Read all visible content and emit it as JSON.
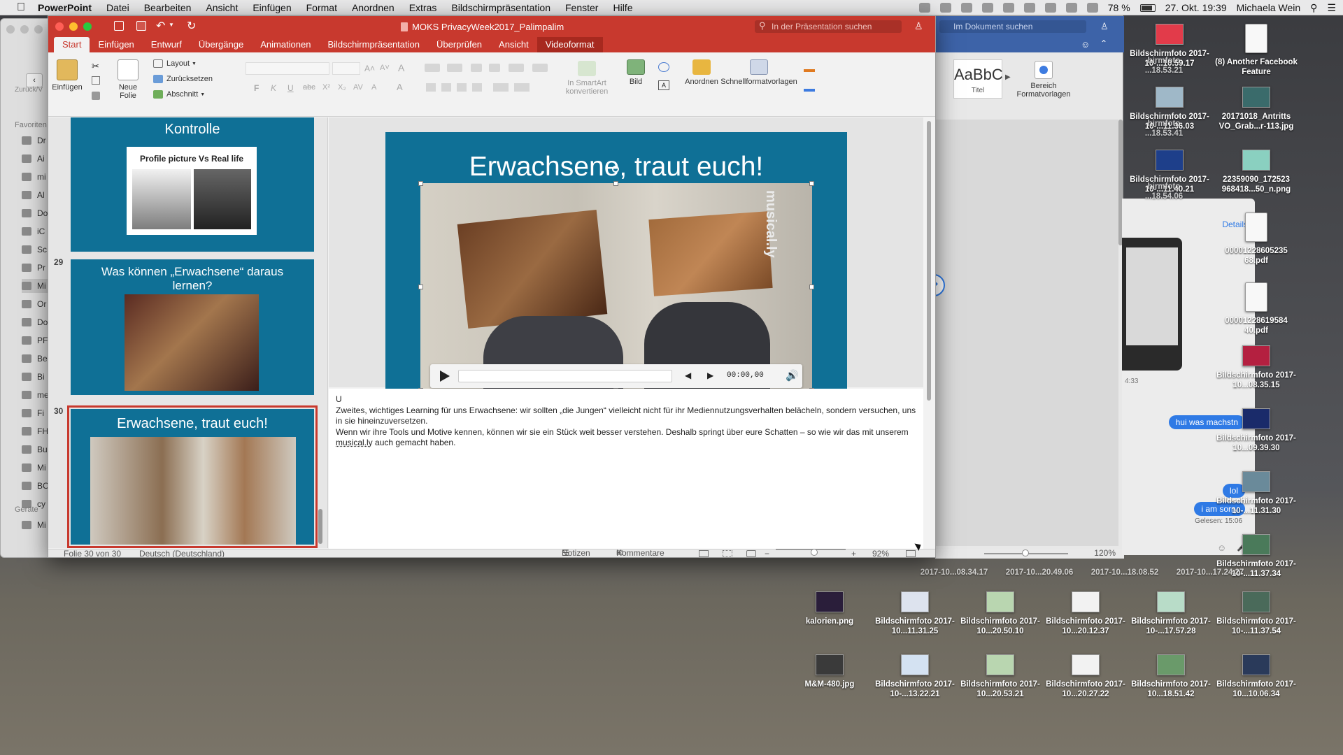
{
  "menubar": {
    "app": "PowerPoint",
    "items": [
      "Datei",
      "Bearbeiten",
      "Ansicht",
      "Einfügen",
      "Format",
      "Anordnen",
      "Extras",
      "Bildschirmpräsentation",
      "Fenster",
      "Hilfe"
    ],
    "battery": "78 %",
    "datetime": "27. Okt. 19:39",
    "user": "Michaela Wein"
  },
  "finder": {
    "back_label": "Zurück/V",
    "favorites_label": "Favoriten",
    "devices_label": "Geräte",
    "items": [
      "Dr",
      "Ai",
      "mi",
      "Al",
      "Do",
      "iC",
      "Sc",
      "Pr",
      "Mi",
      "Or",
      "Do",
      "PF",
      "Be",
      "Bi",
      "me",
      "Fi",
      "FH",
      "Bu",
      "Mi",
      "BC",
      "cy"
    ],
    "device_items": [
      "Mi"
    ]
  },
  "ppt": {
    "title": "MOKS PrivacyWeek2017_Palimpalim",
    "search_placeholder": "In der Präsentation suchen",
    "tabs": [
      "Start",
      "Einfügen",
      "Entwurf",
      "Übergänge",
      "Animationen",
      "Bildschirmpräsentation",
      "Überprüfen",
      "Ansicht",
      "Videoformat"
    ],
    "ribbon": {
      "paste": "Einfügen",
      "new_slide": "Neue Folie",
      "layout": "Layout",
      "reset": "Zurücksetzen",
      "section": "Abschnitt",
      "smartart": "In SmartArt konvertieren",
      "picture": "Bild",
      "arrange": "Anordnen",
      "quickstyles": "Schnellformatvorlagen"
    },
    "thumbnails": [
      {
        "number": "",
        "title": "Kontrolle",
        "caption": "Profile picture Vs Real life"
      },
      {
        "number": "29",
        "title": "Was können „Erwachsene“ daraus lernen?"
      },
      {
        "number": "30",
        "title": "Erwachsene, traut euch!"
      }
    ],
    "slide": {
      "title": "Erwachsene, traut euch!",
      "video_watermark": "musical.ly",
      "time": "00:00,00"
    },
    "notes": {
      "line0": "U",
      "p1": "Zweites, wichtiges Learning für uns Erwachsene: wir sollten „die Jungen“ vielleicht nicht für ihr Mediennutzungsverhalten belächeln, sondern versuchen, uns in sie hineinzuversetzen.",
      "p2a": "Wenn wir ihre Tools und Motive kennen, können wir sie ein Stück weit besser verstehen. Deshalb springt über eure Schatten – so wie wir das mit unserem ",
      "p2link": "musical.ly",
      "p2b": " auch gemacht haben."
    },
    "status": {
      "slide_of": "Folie 30 von 30",
      "language": "Deutsch (Deutschland)",
      "notes": "Notizen",
      "comments": "Kommentare",
      "zoom": "92%"
    }
  },
  "word": {
    "search_placeholder": "Im Dokument suchen",
    "style_sample": "AaBbC",
    "style_name": "Titel",
    "pane_label": "Bereich Formatvorlagen",
    "zoom": "120%"
  },
  "messages": {
    "details": "Details",
    "timestamp": "4:33",
    "bubbles": [
      "hui was machstn",
      "lol",
      "i am sorry"
    ],
    "read": "Gelesen: 15:06"
  },
  "desktop_icons": [
    {
      "label": "Bildschirmfoto 2017-10-...10.59.17"
    },
    {
      "label": "(8) Another Facebook Feature"
    },
    {
      "label": "Bildschirmfoto 2017-10-...11.36.03"
    },
    {
      "label": "20171018_Antritts VO_Grab...r-113.jpg"
    },
    {
      "label": "Bildschirmfoto 2017-10-...11.40.21"
    },
    {
      "label": "22359090_172523 968418...50_n.png"
    },
    {
      "label": "00001228605235 68.pdf"
    },
    {
      "label": "00001228619584 40.pdf"
    },
    {
      "label": "Bildschirmfoto 2017-10...08.35.15"
    },
    {
      "label": "Bildschirmfoto 2017-10...09.39.30"
    },
    {
      "label": "Bildschirmfoto 2017-10-...11.31.30"
    },
    {
      "label": "Bildschirmfoto 2017-10-...11.37.34"
    },
    {
      "label": "kalorien.png"
    },
    {
      "label": "Bildschirmfoto 2017-10...11.31.25"
    },
    {
      "label": "Bildschirmfoto 2017-10...20.50.10"
    },
    {
      "label": "Bildschirmfoto 2017-10...20.12.37"
    },
    {
      "label": "Bildschirmfoto 2017-10-...17.57.28"
    },
    {
      "label": "Bildschirmfoto 2017-10-...11.37.54"
    },
    {
      "label": "M&M-480.jpg"
    },
    {
      "label": "Bildschirmfoto 2017-10-...13.22.21"
    },
    {
      "label": "Bildschirmfoto 2017-10...20.53.21"
    },
    {
      "label": "Bildschirmfoto 2017-10...20.27.22"
    },
    {
      "label": "Bildschirmfoto 2017-10...18.51.42"
    },
    {
      "label": "Bildschirmfoto 2017-10...10.06.34"
    }
  ],
  "partial_labels": [
    "hirmfoto ...18.53.21",
    "hirmfoto ...18.53.41",
    "hirmfoto ...18.54.06",
    "2017-10...08.34.17",
    "2017-10...20.49.06",
    "2017-10...18.08.52",
    "2017-10...17.24.27"
  ]
}
